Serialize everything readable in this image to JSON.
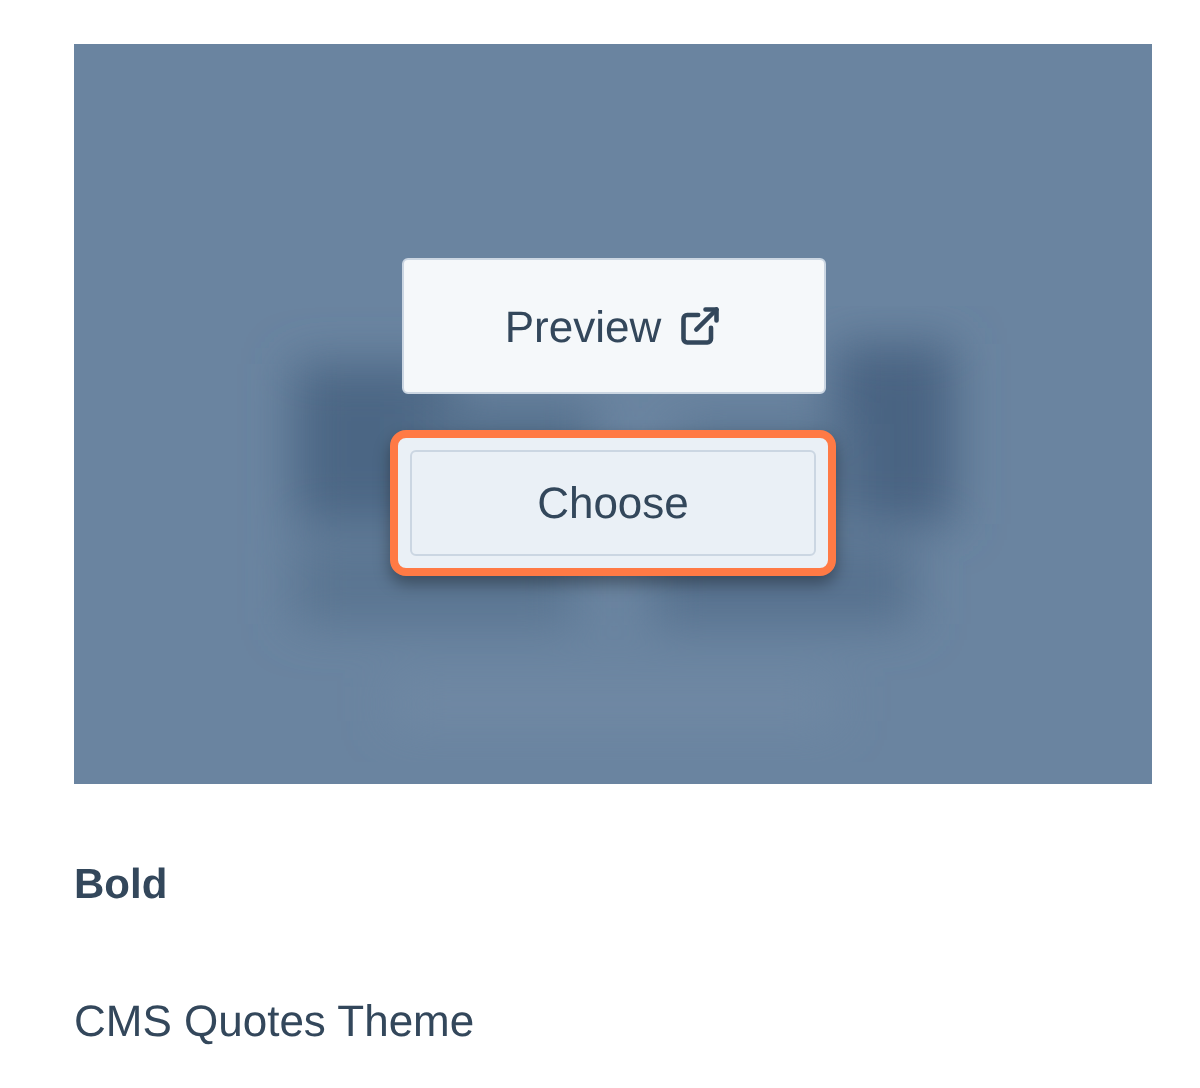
{
  "theme_card": {
    "buttons": [
      {
        "label": "Preview",
        "kind": "external",
        "highlighted": false
      },
      {
        "label": "Choose",
        "kind": "plain",
        "highlighted": true
      }
    ]
  },
  "theme_name": "Bold",
  "theme_subtitle": "CMS Quotes Theme"
}
